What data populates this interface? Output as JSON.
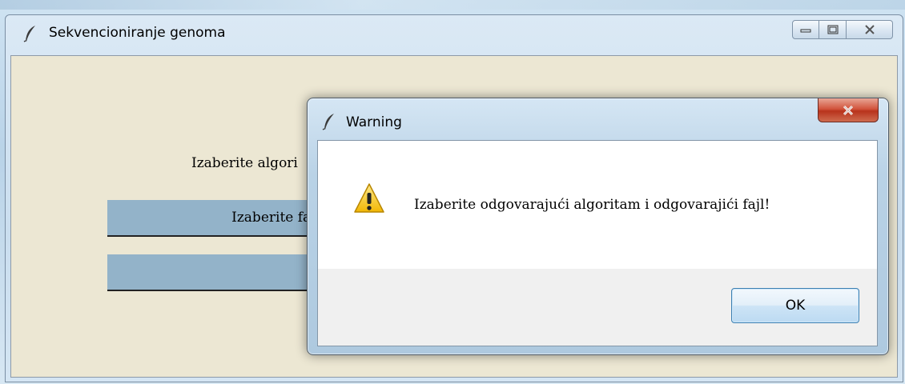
{
  "main_window": {
    "title": "Sekvencioniranje genoma",
    "icon": "feather-icon",
    "controls": {
      "minimize": "minimize-icon",
      "maximize": "maximize-icon",
      "close": "close-icon"
    },
    "algo_label": "Izaberite algori",
    "file_button_label": "Izaberite fajl",
    "run_button_label": "",
    "background_color": "#ece7d3",
    "button_color": "#93b3c9"
  },
  "dialog": {
    "title": "Warning",
    "icon": "feather-icon",
    "close_icon": "close-icon",
    "message_icon": "warning-icon",
    "message": "Izaberite odgovarajući algoritam i odgovarajići fajl!",
    "ok_label": "OK",
    "close_button_color": "#d2553d",
    "warning_color": "#f4c20d"
  }
}
